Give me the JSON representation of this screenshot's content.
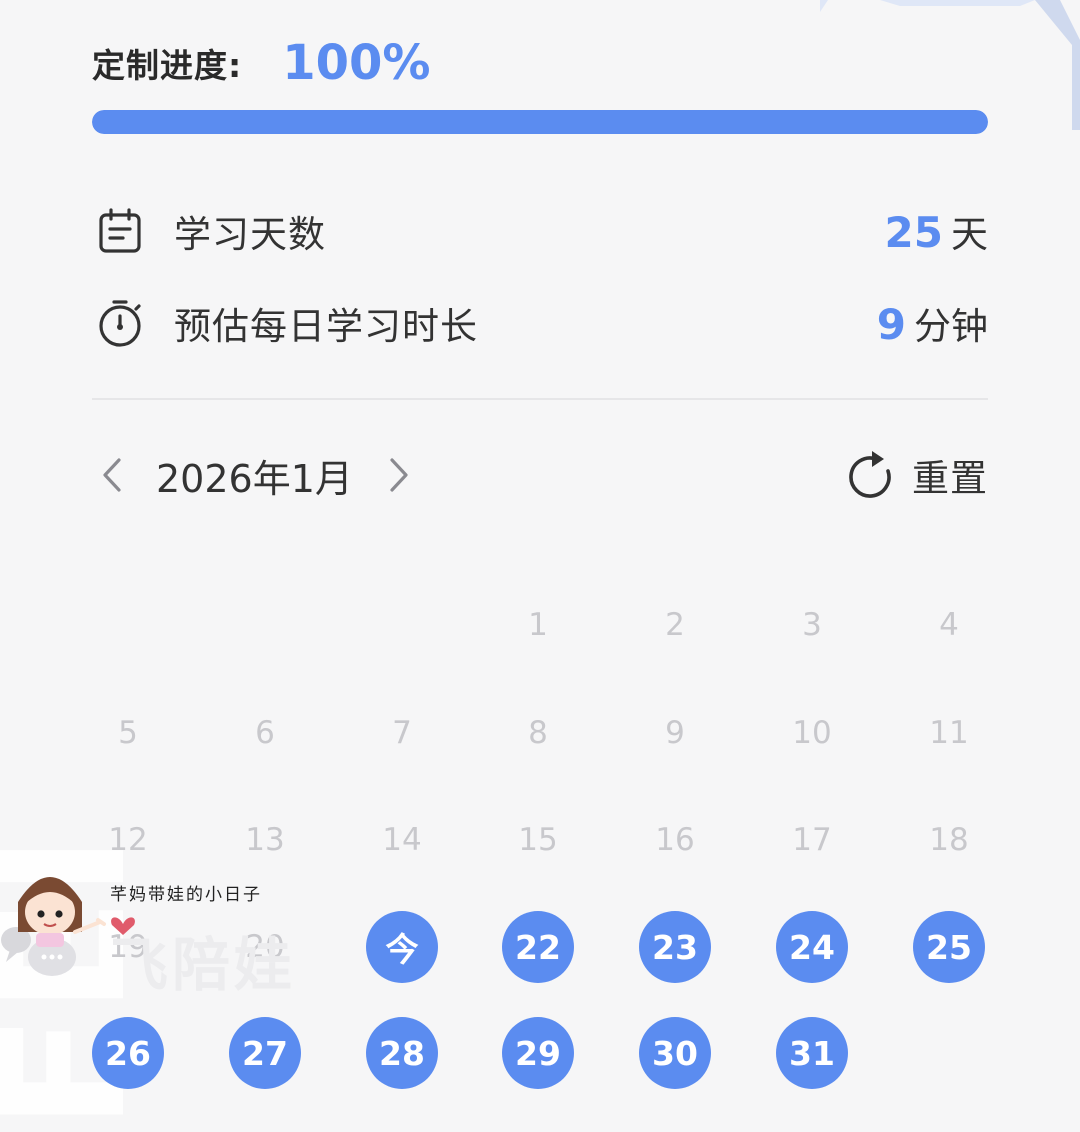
{
  "progress": {
    "label": "定制进度:",
    "value_text": "100%",
    "fraction": 1.0
  },
  "stats": {
    "days": {
      "label": "学习天数",
      "number": "25",
      "unit": "天",
      "icon": "calendar-icon"
    },
    "daily": {
      "label": "预估每日学习时长",
      "number": "9",
      "unit": "分钟",
      "icon": "stopwatch-icon"
    }
  },
  "calendar": {
    "month_label": "2026年1月",
    "reset_label": "重置",
    "start_weekday_index": 3,
    "today_label": "今",
    "weeks": [
      [
        "",
        "",
        "",
        "1",
        "2",
        "3",
        "4"
      ],
      [
        "5",
        "6",
        "7",
        "8",
        "9",
        "10",
        "11"
      ],
      [
        "12",
        "13",
        "14",
        "15",
        "16",
        "17",
        "18"
      ],
      [
        "19",
        "20",
        "今",
        "22",
        "23",
        "24",
        "25"
      ],
      [
        "26",
        "27",
        "28",
        "29",
        "30",
        "31",
        ""
      ]
    ],
    "selected": [
      "今",
      "22",
      "23",
      "24",
      "25",
      "26",
      "27",
      "28",
      "29",
      "30",
      "31"
    ]
  },
  "overlay": {
    "caption": "芊妈带娃的小日子",
    "brand": "飞陪娃"
  },
  "colors": {
    "accent": "#5b8cf0",
    "muted_day": "#c8c8cc",
    "text": "#333333"
  }
}
